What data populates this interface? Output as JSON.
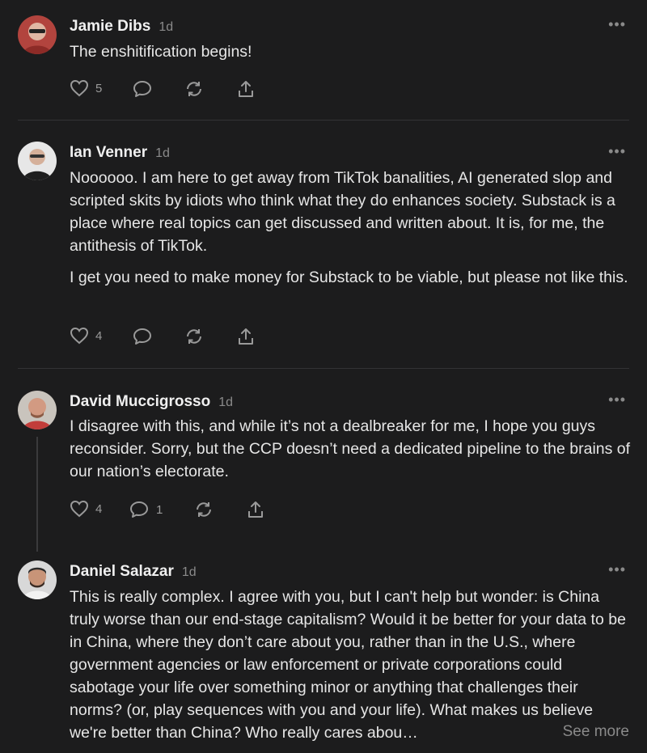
{
  "comments": [
    {
      "author": "Jamie Dibs",
      "time": "1d",
      "paragraphs": [
        "The enshitification begins!"
      ],
      "likes": "5",
      "replies": ""
    },
    {
      "author": "Ian Venner",
      "time": "1d",
      "paragraphs": [
        "Noooooo. I am here to get away from TikTok banalities, AI generated slop and scripted skits by idiots who think what they do enhances society. Substack is a place where real topics can get discussed and written about. It is, for me, the antithesis of TikTok.",
        "I get you need to make money for Substack to be viable, but please not like this."
      ],
      "likes": "4",
      "replies": ""
    },
    {
      "author": "David Muccigrosso",
      "time": "1d",
      "paragraphs": [
        "I disagree with this, and while it’s not a dealbreaker for me, I hope you guys reconsider. Sorry, but the CCP doesn’t need a dedicated pipeline to the brains of our nation’s electorate."
      ],
      "likes": "4",
      "replies": "1"
    },
    {
      "author": "Daniel Salazar",
      "time": "1d",
      "paragraphs": [
        "This is really complex. I agree with you, but I can't help but wonder: is China truly worse than our end-stage capitalism? Would it be better for your data to be in China, where they don’t care about you, rather than in the U.S., where government agencies or law enforcement or private corporations could sabotage your life over something minor or anything that challenges their norms? (or, play sequences with you and your life). What makes us believe we're better than China? Who really cares abou…"
      ],
      "likes": "",
      "replies": ""
    }
  ],
  "more_menu": "•••",
  "see_more": "See more",
  "icons": {
    "like": "heart-icon",
    "reply": "comment-bubble-icon",
    "restack": "restack-icon",
    "share": "share-icon",
    "more": "ellipsis-icon"
  },
  "colors": {
    "background": "#1c1c1d",
    "text": "#e6e6e6",
    "muted": "#8a8a8a",
    "divider": "#333335"
  }
}
